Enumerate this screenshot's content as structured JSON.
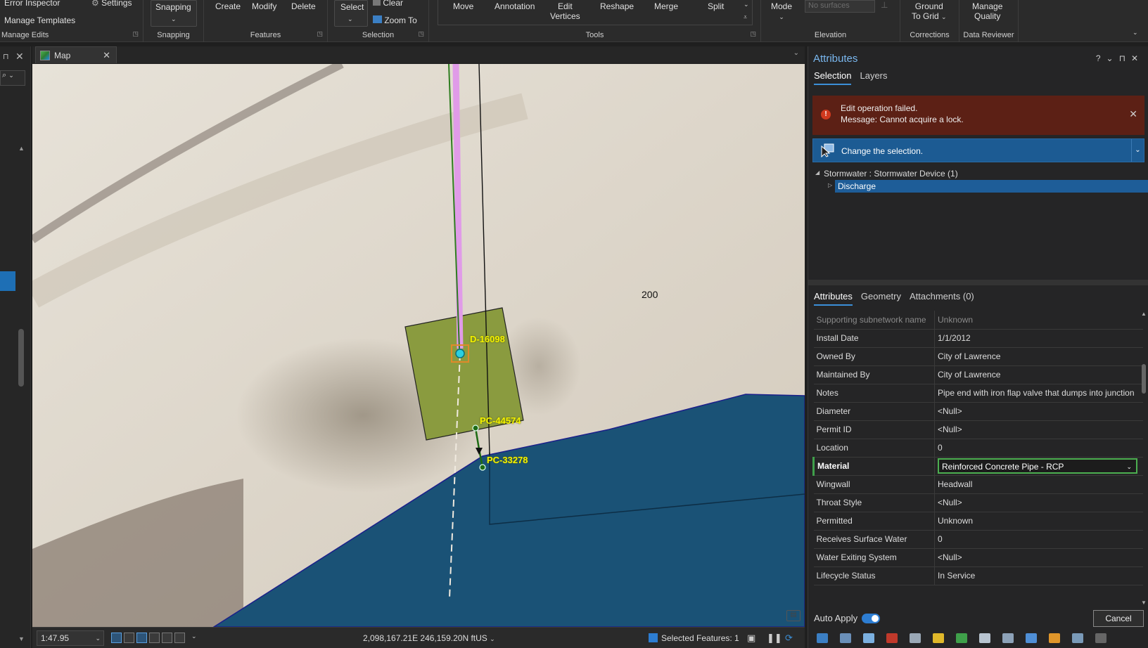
{
  "ribbon": {
    "manage_edits": {
      "error_inspector": "Error Inspector",
      "settings": "Settings",
      "manage_templates": "Manage Templates",
      "label": "Manage Edits"
    },
    "snapping": {
      "button": "Snapping",
      "label": "Snapping"
    },
    "features": {
      "create": "Create",
      "modify": "Modify",
      "delete": "Delete",
      "label": "Features"
    },
    "selection": {
      "select": "Select",
      "clear": "Clear",
      "zoom_to": "Zoom To",
      "label": "Selection"
    },
    "tools": {
      "move": "Move",
      "annotation": "Annotation",
      "edit_vertices_1": "Edit",
      "edit_vertices_2": "Vertices",
      "reshape": "Reshape",
      "merge": "Merge",
      "split": "Split",
      "label": "Tools"
    },
    "elevation": {
      "mode": "Mode",
      "surfaces_placeholder": "No surfaces",
      "label": "Elevation"
    },
    "corrections": {
      "ground_1": "Ground",
      "ground_2": "To Grid",
      "label": "Corrections"
    },
    "data_reviewer": {
      "manage_1": "Manage",
      "manage_2": "Quality",
      "label": "Data Reviewer"
    }
  },
  "map_tab": {
    "label": "Map"
  },
  "map": {
    "labels": {
      "d": "D-16098",
      "pc1": "PC-44574",
      "pc2": "PC-33278",
      "num": "200"
    },
    "colors": {
      "water": "#1a5276",
      "polygon": "#8a9b3f",
      "pipe": "#e09be8",
      "line": "#2e7d1f"
    }
  },
  "status": {
    "scale": "1:47.95",
    "coords": "2,098,167.21E 246,159.20N ftUS",
    "selected_features": "Selected Features: 1"
  },
  "attributes": {
    "title": "Attributes",
    "tabs_top": [
      "Selection",
      "Layers"
    ],
    "error": {
      "line1": "Edit operation failed.",
      "line2": "Message: Cannot acquire a lock."
    },
    "change_selection": "Change the selection.",
    "tree": {
      "parent": "Stormwater : Stormwater Device (1)",
      "child": "Discharge"
    },
    "tabs_bottom": [
      "Attributes",
      "Geometry",
      "Attachments (0)"
    ],
    "rows": [
      {
        "field": "Supporting subnetwork name",
        "value": "Unknown"
      },
      {
        "field": "Install Date",
        "value": "1/1/2012"
      },
      {
        "field": "Owned By",
        "value": "City of Lawrence"
      },
      {
        "field": "Maintained By",
        "value": "City of Lawrence"
      },
      {
        "field": "Notes",
        "value": "Pipe end with iron flap valve that dumps into junction"
      },
      {
        "field": "Diameter",
        "value": "<Null>"
      },
      {
        "field": "Permit ID",
        "value": "<Null>"
      },
      {
        "field": "Location",
        "value": "0"
      },
      {
        "field": "Material",
        "value": "Reinforced Concrete Pipe - RCP"
      },
      {
        "field": "Wingwall",
        "value": "Headwall"
      },
      {
        "field": "Throat Style",
        "value": "<Null>"
      },
      {
        "field": "Permitted",
        "value": "Unknown"
      },
      {
        "field": "Receives Surface Water",
        "value": "0"
      },
      {
        "field": "Water Exiting System",
        "value": "<Null>"
      },
      {
        "field": "Lifecycle Status",
        "value": "In Service"
      }
    ],
    "auto_apply": "Auto Apply",
    "cancel": "Cancel"
  }
}
